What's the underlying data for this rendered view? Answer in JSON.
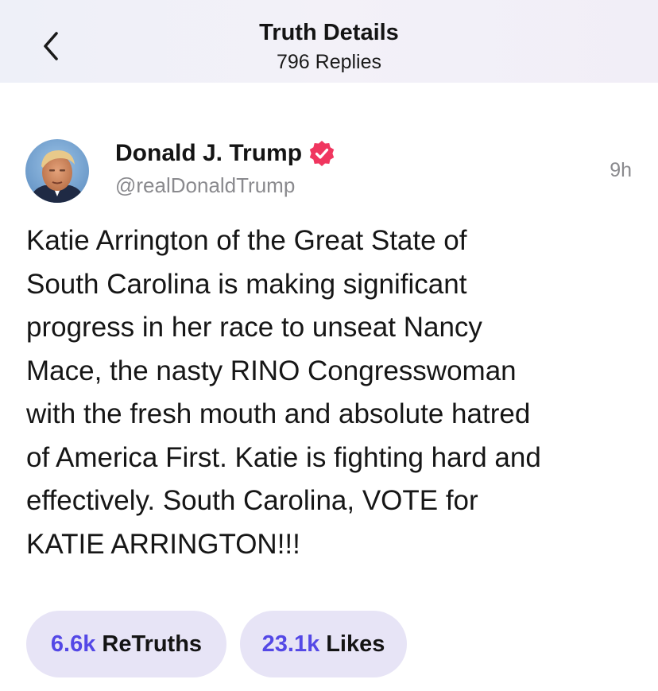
{
  "header": {
    "title": "Truth Details",
    "subtitle": "796 Replies",
    "back_icon": "chevron-left-icon"
  },
  "post": {
    "author_name": "Donald J. Trump",
    "verified_icon": "verified-badge-icon",
    "verified_color": "#f0365f",
    "handle": "@realDonaldTrump",
    "timestamp": "9h",
    "body": "Katie Arrington of the Great State of\nSouth Carolina is making significant\nprogress in her race to unseat Nancy\nMace, the nasty RINO Congresswoman\nwith the fresh mouth and absolute hatred\nof America First. Katie is fighting hard and\neffectively. South Carolina, VOTE for\nKATIE ARRINGTON!!!"
  },
  "stats": {
    "retruths_count": "6.6k",
    "retruths_label": "ReTruths",
    "likes_count": "23.1k",
    "likes_label": "Likes"
  },
  "colors": {
    "accent": "#5448e6",
    "pill_bg": "#e7e4f6",
    "header_bg": "#f0f0f8"
  }
}
